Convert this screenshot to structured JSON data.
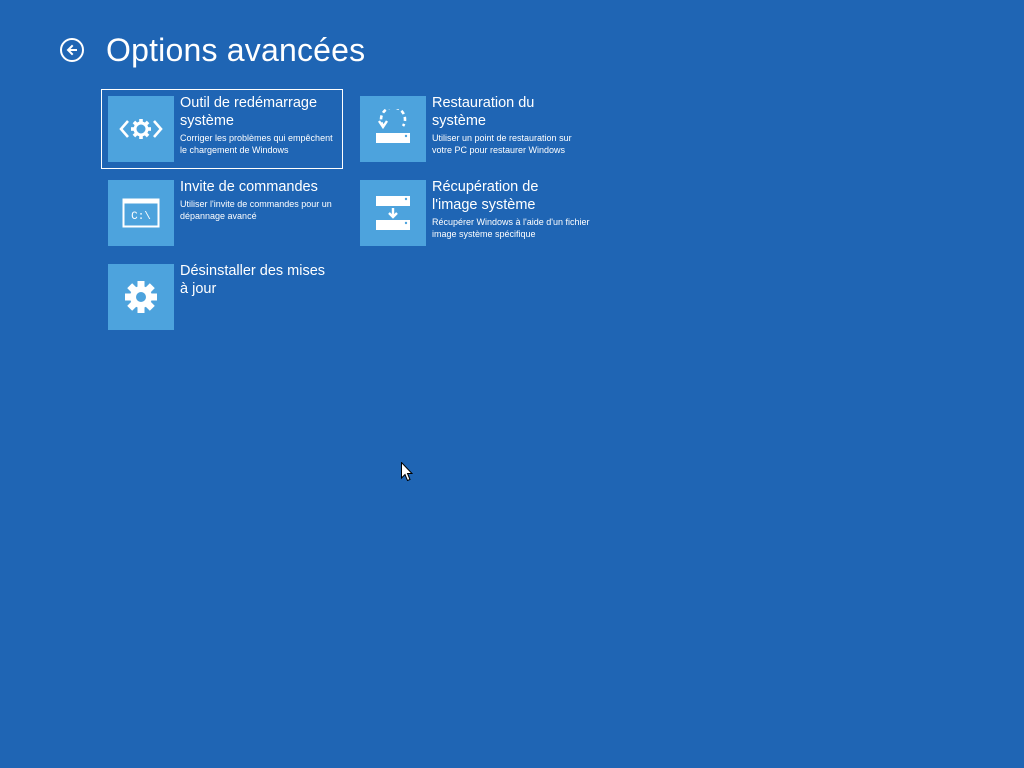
{
  "header": {
    "back_icon": "back-arrow-circle-icon",
    "title": "Options avancées"
  },
  "options": [
    {
      "title": "Outil de redémarrage\nsystème",
      "description": "Corriger les problèmes qui empêchent\nle chargement de Windows",
      "icon": "startup-repair-icon",
      "selected": true
    },
    {
      "title": "Restauration du\nsystème",
      "description": "Utiliser un point de restauration sur\nvotre PC pour restaurer Windows",
      "icon": "system-restore-icon",
      "selected": false
    },
    {
      "title": "Invite de commandes",
      "description": "Utiliser l'invite de commandes pour un\ndépannage avancé",
      "icon": "command-prompt-icon",
      "icon_text": "C:\\",
      "selected": false
    },
    {
      "title": "Récupération de\nl'image système",
      "description": "Récupérer Windows à l'aide d'un fichier\nimage système spécifique",
      "icon": "system-image-recovery-icon",
      "selected": false
    },
    {
      "title": "Désinstaller des mises\nà jour",
      "description": "",
      "icon": "uninstall-updates-gear-icon",
      "selected": false
    }
  ],
  "colors": {
    "background": "#1F65B4",
    "tile_icon_bg": "#4DA3DD",
    "text": "#FFFFFF"
  },
  "cursor": {
    "icon": "mouse-pointer-icon"
  }
}
